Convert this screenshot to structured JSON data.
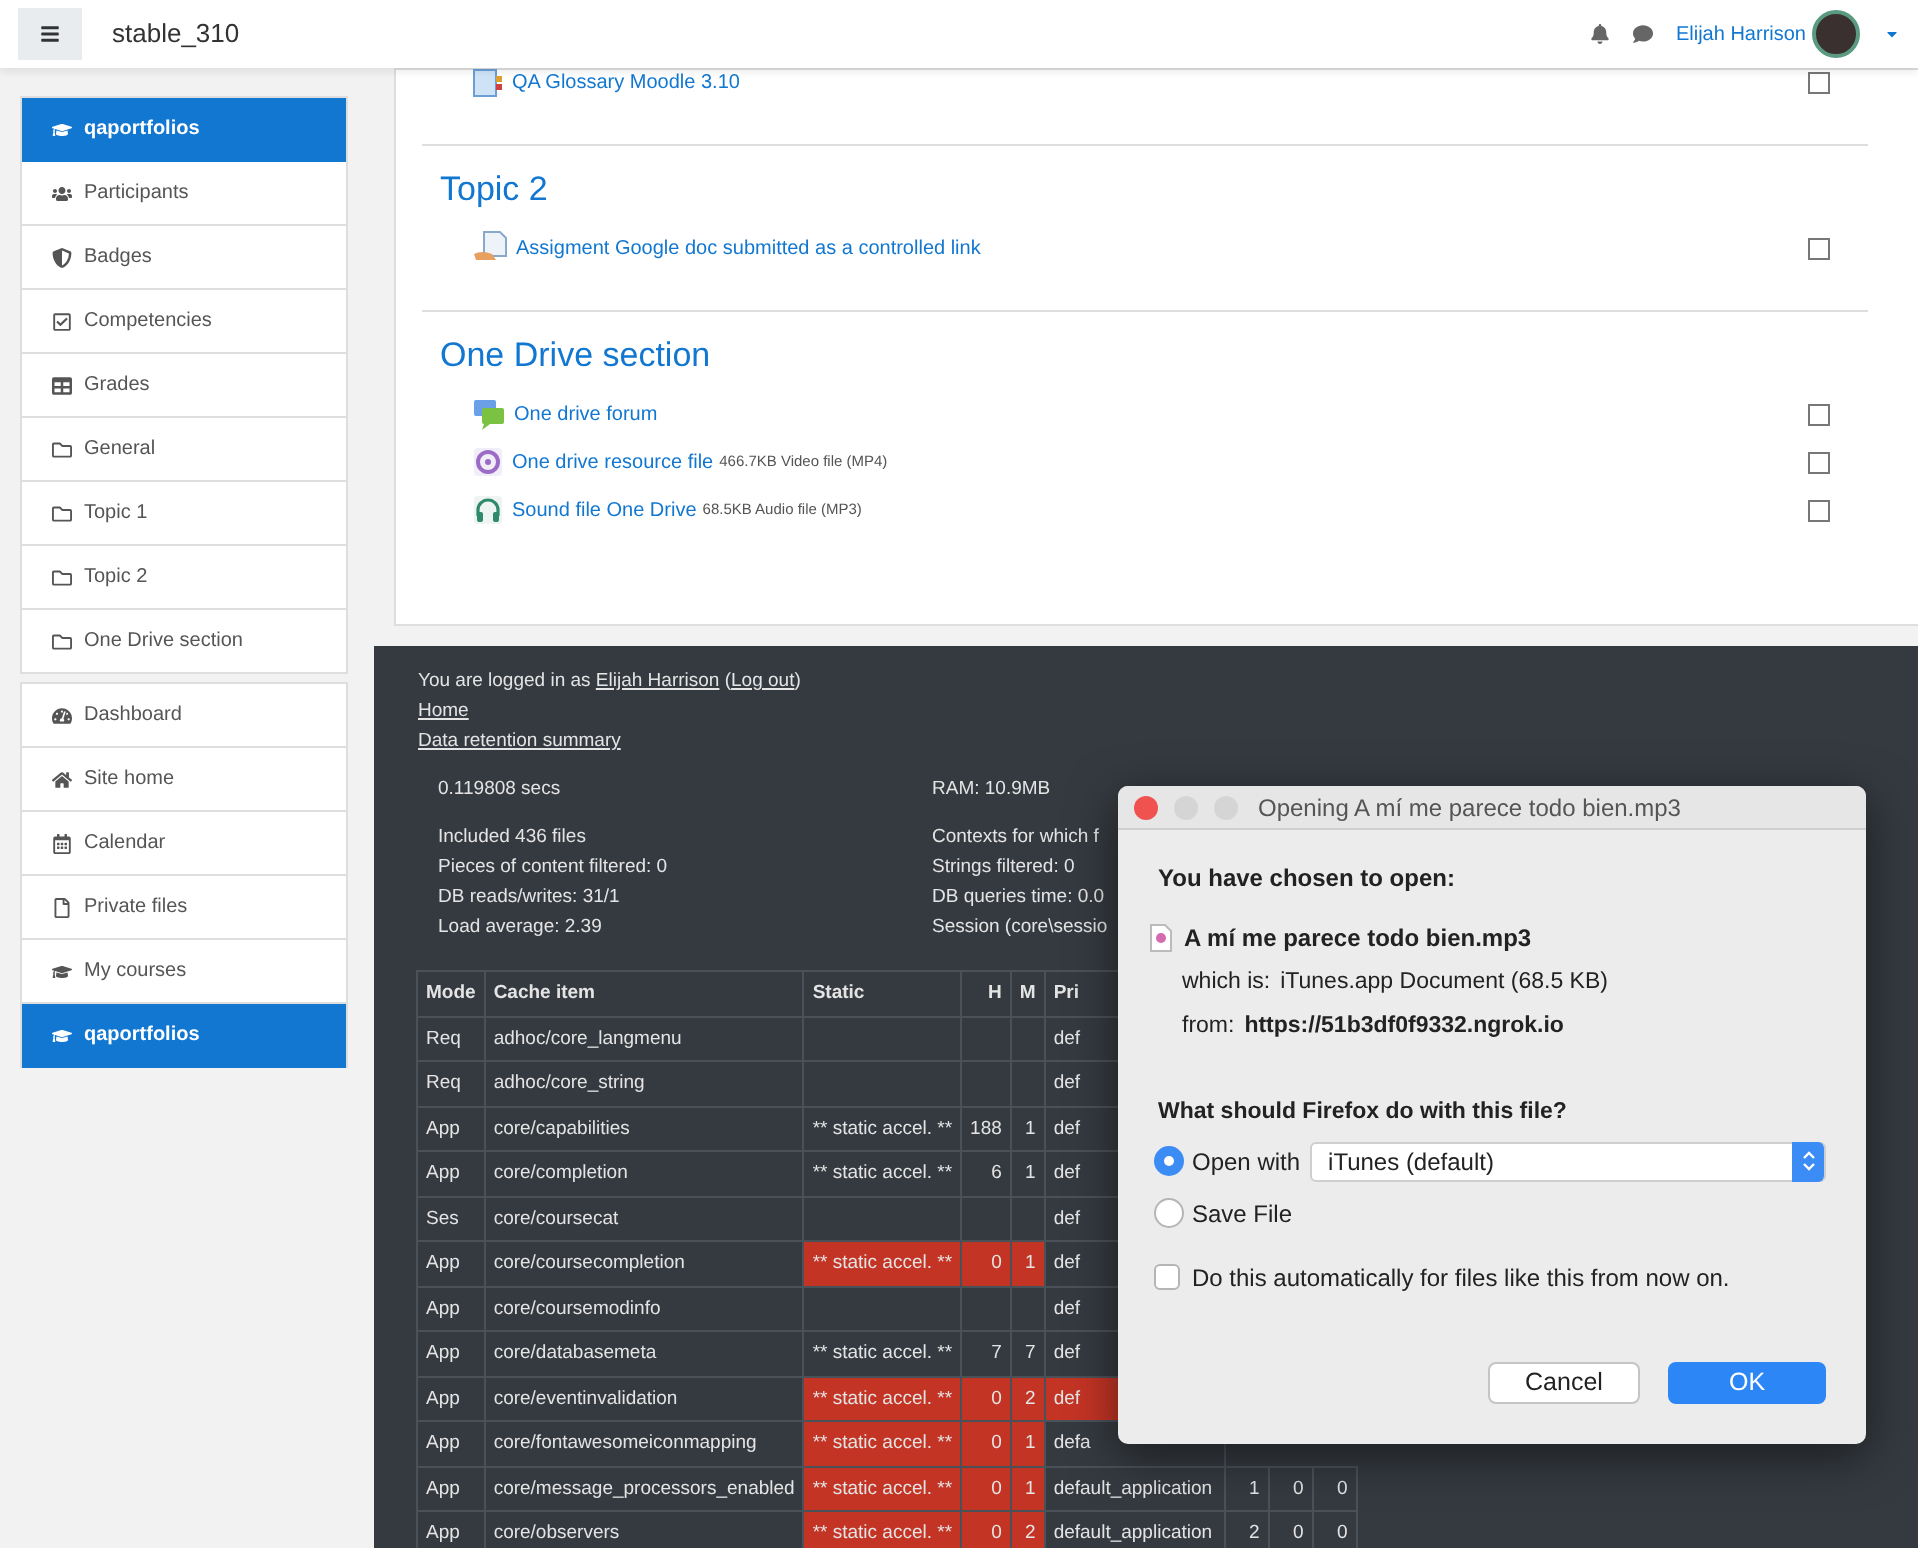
{
  "header": {
    "site_name": "stable_310",
    "user_name": "Elijah Harrison"
  },
  "sidebar": {
    "groups": [
      {
        "items": [
          {
            "label": "qaportfolios",
            "kind": "course",
            "selected": true
          },
          {
            "label": "Participants",
            "kind": "users",
            "selected": false
          },
          {
            "label": "Badges",
            "kind": "badge",
            "selected": false
          },
          {
            "label": "Competencies",
            "kind": "check",
            "selected": false
          },
          {
            "label": "Grades",
            "kind": "table",
            "selected": false
          },
          {
            "label": "General",
            "kind": "folder",
            "selected": false
          },
          {
            "label": "Topic 1",
            "kind": "folder",
            "selected": false
          },
          {
            "label": "Topic 2",
            "kind": "folder",
            "selected": false
          },
          {
            "label": "One Drive section",
            "kind": "folder",
            "selected": false
          }
        ]
      },
      {
        "items": [
          {
            "label": "Dashboard",
            "kind": "dashboard",
            "selected": false
          },
          {
            "label": "Site home",
            "kind": "home",
            "selected": false
          },
          {
            "label": "Calendar",
            "kind": "calendar",
            "selected": false
          },
          {
            "label": "Private files",
            "kind": "file",
            "selected": false
          },
          {
            "label": "My courses",
            "kind": "course",
            "selected": false
          },
          {
            "label": "qaportfolios",
            "kind": "course",
            "selected": true
          }
        ]
      }
    ]
  },
  "sections": [
    {
      "activities": [
        {
          "name": "QA Glossary Moodle 3.10",
          "kind": "glossary",
          "checked": false
        }
      ]
    },
    {
      "title": "Topic 2",
      "activities": [
        {
          "name": "Assigment Google doc submitted as a controlled link",
          "kind": "assignment",
          "checked": false
        }
      ]
    },
    {
      "title": "One Drive section",
      "activities": [
        {
          "name": "One drive forum",
          "kind": "forum",
          "checked": false
        },
        {
          "name": "One drive resource file",
          "meta": "466.7KB Video file (MP4)",
          "kind": "video",
          "checked": false
        },
        {
          "name": "Sound file One Drive",
          "meta": "68.5KB Audio file (MP3)",
          "kind": "audio",
          "checked": false
        }
      ]
    }
  ],
  "footer": {
    "login_line": [
      {
        "text": "You are logged in as ",
        "link": false
      },
      {
        "text": "Elijah Harrison",
        "link": true
      },
      {
        "text": " (",
        "link": false
      },
      {
        "text": "Log out",
        "link": true
      },
      {
        "text": ")",
        "link": false
      }
    ],
    "links": [
      "Home",
      "Data retention summary"
    ],
    "stats_left": [
      [
        "0.119808 secs"
      ],
      [
        "Included 436 files",
        "Pieces of content filtered: 0",
        "DB reads/writes: 31/1",
        "Load average: 2.39"
      ]
    ],
    "stats_right": [
      [
        "RAM: 10.9MB"
      ],
      [
        "Contexts for which f",
        "Strings filtered: 0",
        "DB queries time: 0.0",
        "Session (core\\sessio"
      ]
    ],
    "table": {
      "columns": [
        "Mode",
        "Cache item",
        "Static",
        "H",
        "M",
        "Pri"
      ],
      "rows": [
        {
          "mode": "Req",
          "item": "adhoc/core_langmenu",
          "pri": "def",
          "alert": false,
          "pri_alert": false
        },
        {
          "mode": "Req",
          "item": "adhoc/core_string",
          "pri": "def",
          "alert": false,
          "pri_alert": false
        },
        {
          "mode": "App",
          "item": "core/capabilities",
          "static": "** static accel. **",
          "h": "188",
          "m": "1",
          "pri": "def",
          "alert": false,
          "pri_alert": false
        },
        {
          "mode": "App",
          "item": "core/completion",
          "static": "** static accel. **",
          "h": "6",
          "m": "1",
          "pri": "def",
          "alert": false,
          "pri_alert": false
        },
        {
          "mode": "Ses",
          "item": "core/coursecat",
          "pri": "def",
          "alert": false,
          "pri_alert": false
        },
        {
          "mode": "App",
          "item": "core/coursecompletion",
          "static": "** static accel. **",
          "h": "0",
          "m": "1",
          "pri": "def",
          "alert": true,
          "pri_alert": false
        },
        {
          "mode": "App",
          "item": "core/coursemodinfo",
          "pri": "def",
          "alert": false,
          "pri_alert": false
        },
        {
          "mode": "App",
          "item": "core/databasemeta",
          "static": "** static accel. **",
          "h": "7",
          "m": "7",
          "pri": "def",
          "alert": false,
          "pri_alert": false
        },
        {
          "mode": "App",
          "item": "core/eventinvalidation",
          "static": "** static accel. **",
          "h": "0",
          "m": "2",
          "pri": "def",
          "alert": true,
          "pri_alert": true
        },
        {
          "mode": "App",
          "item": "core/fontawesomeiconmapping",
          "static": "** static accel. **",
          "h": "0",
          "m": "1",
          "pri": "defa",
          "alert": true,
          "pri_alert": false
        },
        {
          "mode": "App",
          "item": "core/message_processors_enabled",
          "static": "** static accel. **",
          "h": "0",
          "m": "1",
          "pri": "default_application",
          "extra": [
            "1",
            "0",
            "0"
          ],
          "alert": true,
          "pri_alert": false
        },
        {
          "mode": "App",
          "item": "core/observers",
          "static": "** static accel. **",
          "h": "0",
          "m": "2",
          "pri": "default_application",
          "extra": [
            "2",
            "0",
            "0"
          ],
          "alert": true,
          "pri_alert": false
        }
      ]
    }
  },
  "dialog": {
    "title": "Opening A mí me parece todo bien.mp3",
    "heading": "You have chosen to open:",
    "file_name": "A mí me parece todo bien.mp3",
    "details": [
      {
        "label": "which is:",
        "value": "iTunes.app Document (68.5 KB)",
        "bold": false
      },
      {
        "label": "from:",
        "value": "https://51b3df0f9332.ngrok.io",
        "bold": true
      }
    ],
    "question": "What should Firefox do with this file?",
    "options": [
      {
        "label": "Open with",
        "selected": true,
        "select_value": "iTunes (default)"
      },
      {
        "label": "Save File",
        "selected": false
      }
    ],
    "auto_checkbox": {
      "label": "Do this automatically for files like this from now on.",
      "checked": false
    },
    "buttons": [
      {
        "label": "Cancel",
        "kind": "default"
      },
      {
        "label": "OK",
        "kind": "primary"
      }
    ]
  }
}
